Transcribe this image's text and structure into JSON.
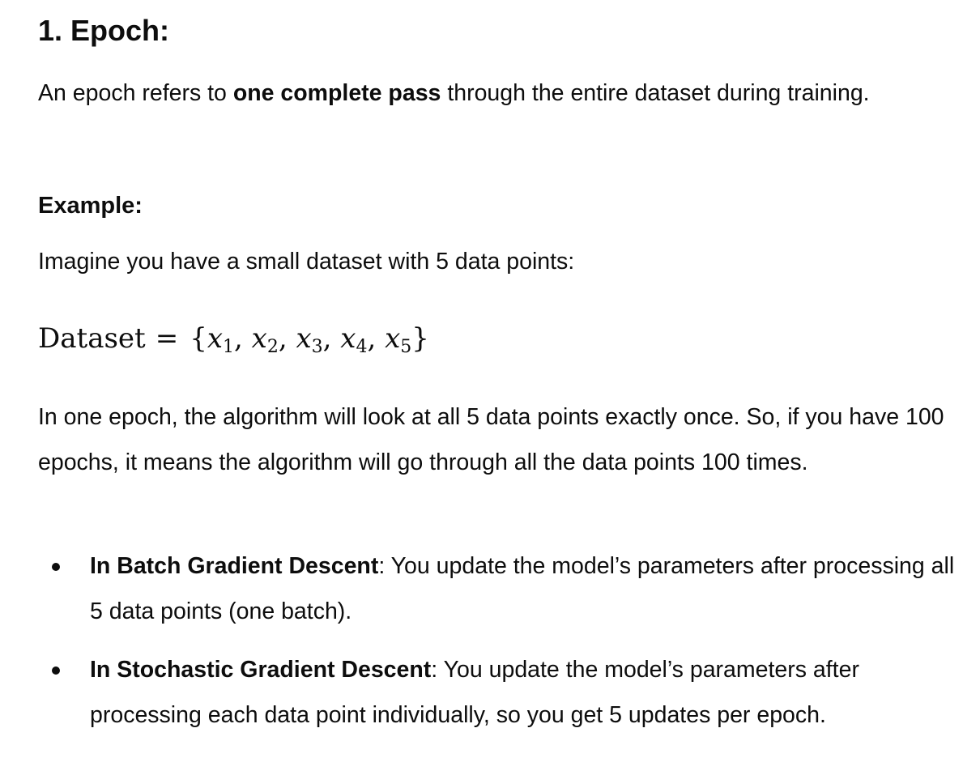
{
  "heading": "1. Epoch:",
  "intro": {
    "before": "An epoch refers to ",
    "bold": "one complete pass",
    "after": " through the entire dataset during training."
  },
  "example_heading": "Example:",
  "example_text": "Imagine you have a small dataset with 5 data points:",
  "formula": {
    "lhs": "Dataset",
    "equals": "=",
    "open_brace": "{",
    "close_brace": "}",
    "terms": [
      {
        "var": "x",
        "sub": "1"
      },
      {
        "var": "x",
        "sub": "2"
      },
      {
        "var": "x",
        "sub": "3"
      },
      {
        "var": "x",
        "sub": "4"
      },
      {
        "var": "x",
        "sub": "5"
      }
    ],
    "separator": ", "
  },
  "epoch_explanation": "In one epoch, the algorithm will look at all 5 data points exactly once. So, if you have 100 epochs, it means the algorithm will go through all the data points 100 times.",
  "bullets": [
    {
      "bold": "In Batch Gradient Descent",
      "text": ": You update the model’s parameters after processing all 5 data points (one batch)."
    },
    {
      "bold": "In Stochastic Gradient Descent",
      "text": ": You update the model’s parameters after processing each data point individually, so you get 5 updates per epoch."
    }
  ]
}
